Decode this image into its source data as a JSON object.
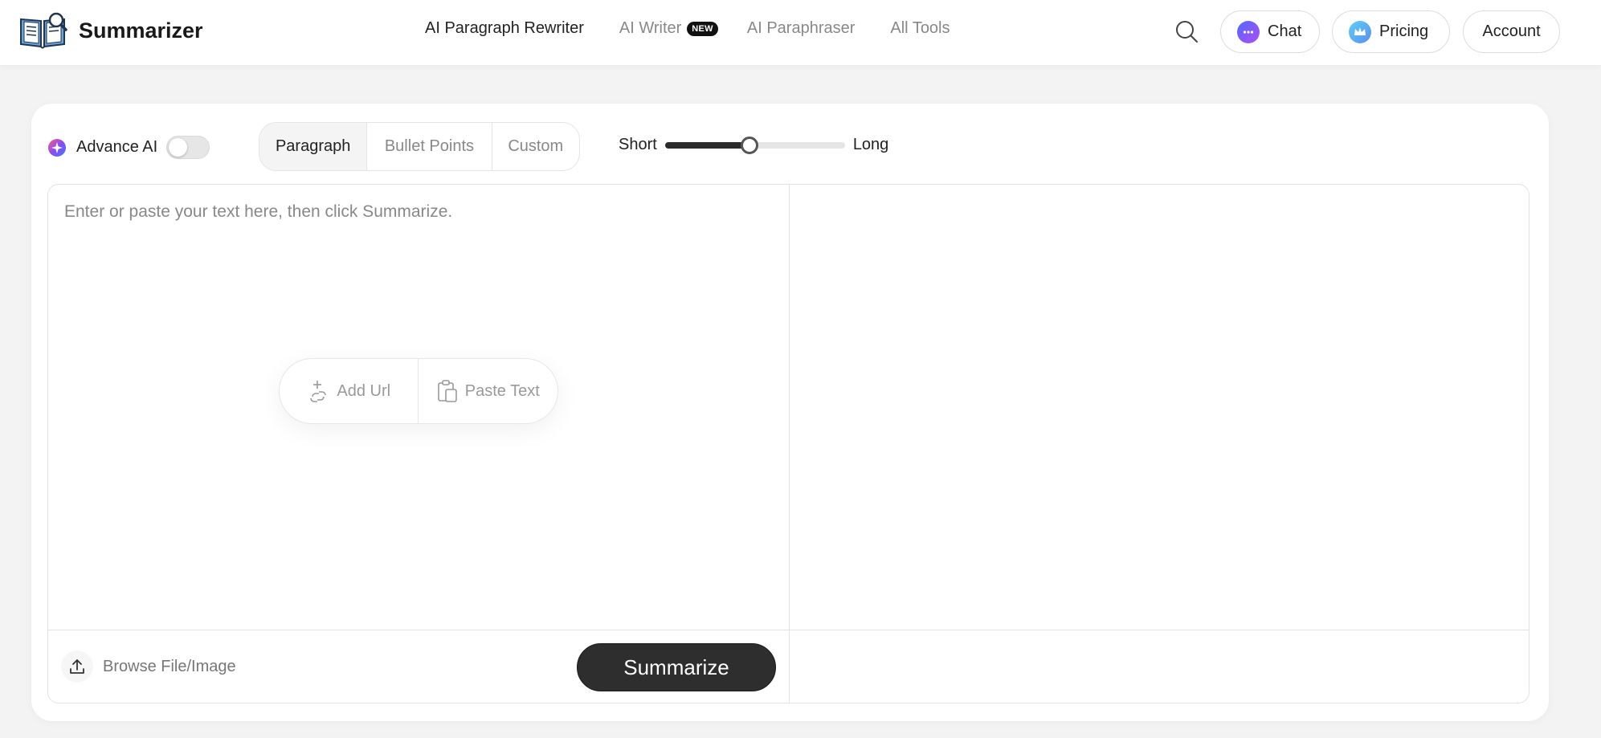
{
  "brand": {
    "name": "Summarizer",
    "logo_icon": "book-magnifier-icon"
  },
  "nav": {
    "items": [
      {
        "label": "AI Paragraph Rewriter",
        "active": true
      },
      {
        "label": "AI Writer",
        "badge": "NEW"
      },
      {
        "label": "AI Paraphraser"
      },
      {
        "label": "All Tools"
      }
    ]
  },
  "header_actions": {
    "search_icon": "search-icon",
    "chat_label": "Chat",
    "pricing_label": "Pricing",
    "account_label": "Account"
  },
  "toolbar": {
    "advance_ai_label": "Advance AI",
    "advance_ai_enabled": false,
    "modes": [
      "Paragraph",
      "Bullet Points",
      "Custom"
    ],
    "selected_mode": "Paragraph",
    "length_min_label": "Short",
    "length_max_label": "Long",
    "length_value": 0.47
  },
  "editor": {
    "placeholder": "Enter or paste your text here, then click Summarize.",
    "add_url_label": "Add Url",
    "paste_text_label": "Paste Text",
    "browse_label": "Browse File/Image",
    "summarize_label": "Summarize"
  },
  "colors": {
    "accent_dark": "#2e2e2e",
    "chat_icon": "#7b4cf5",
    "pricing_icon": "#5b8def",
    "background": "#f3f3f3"
  }
}
